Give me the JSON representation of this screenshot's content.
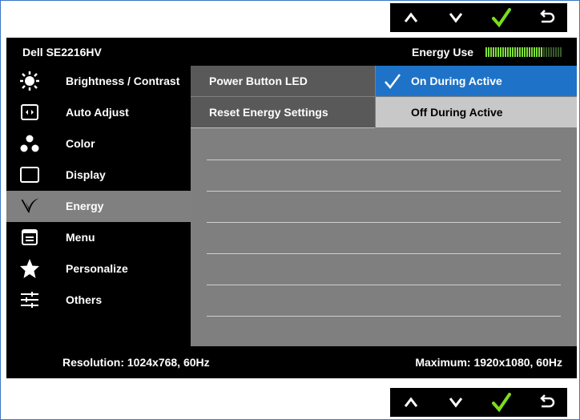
{
  "header": {
    "model": "Dell SE2216HV",
    "energy_use_label": "Energy Use",
    "energy_meter_level": 0.75
  },
  "buttons": [
    {
      "name": "up-button",
      "icon": "chevron-up-icon"
    },
    {
      "name": "down-button",
      "icon": "chevron-down-icon"
    },
    {
      "name": "ok-button",
      "icon": "checkmark-icon"
    },
    {
      "name": "back-button",
      "icon": "return-arrow-icon"
    }
  ],
  "sidebar": {
    "items": [
      {
        "label": "Brightness / Contrast",
        "icon": "brightness-icon"
      },
      {
        "label": "Auto Adjust",
        "icon": "auto-adjust-icon"
      },
      {
        "label": "Color",
        "icon": "color-icon"
      },
      {
        "label": "Display",
        "icon": "display-icon"
      },
      {
        "label": "Energy",
        "icon": "energy-leaf-icon",
        "active": true
      },
      {
        "label": "Menu",
        "icon": "menu-icon"
      },
      {
        "label": "Personalize",
        "icon": "star-icon"
      },
      {
        "label": "Others",
        "icon": "sliders-icon"
      }
    ]
  },
  "submenu": {
    "items": [
      {
        "label": "Power Button LED",
        "selected": true
      },
      {
        "label": "Reset Energy Settings"
      }
    ]
  },
  "options": {
    "items": [
      {
        "label": "On During Active",
        "checked": true
      },
      {
        "label": "Off During Active"
      }
    ]
  },
  "footer": {
    "resolution": "Resolution: 1024x768, 60Hz",
    "maximum": "Maximum: 1920x1080, 60Hz"
  },
  "colors": {
    "accent": "#1e73c8",
    "active_bg": "#808080",
    "meter_on": "#7fe03a",
    "check": "#7ddc1f"
  }
}
